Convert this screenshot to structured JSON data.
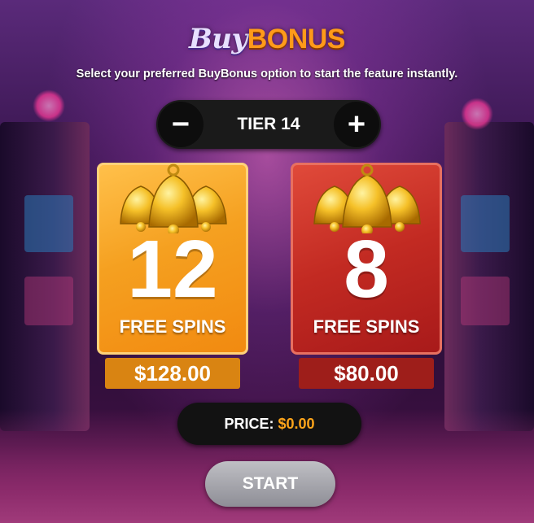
{
  "header": {
    "title_buy": "Buy",
    "title_bonus": "BONUS",
    "subtitle": "Select your preferred BuyBonus option to start the feature instantly."
  },
  "tier_selector": {
    "minus_label": "−",
    "plus_label": "+",
    "tier_label": "TIER 14"
  },
  "options": [
    {
      "spins": "12",
      "spins_label": "FREE SPINS",
      "price": "$128.00",
      "color": "#f5a020"
    },
    {
      "spins": "8",
      "spins_label": "FREE SPINS",
      "price": "$80.00",
      "color": "#c22a22"
    }
  ],
  "price_bar": {
    "label": "PRICE: ",
    "amount": "$0.00"
  },
  "start_button": {
    "label": "START"
  },
  "icons": [
    "bells-icon",
    "minus-icon",
    "plus-icon"
  ]
}
